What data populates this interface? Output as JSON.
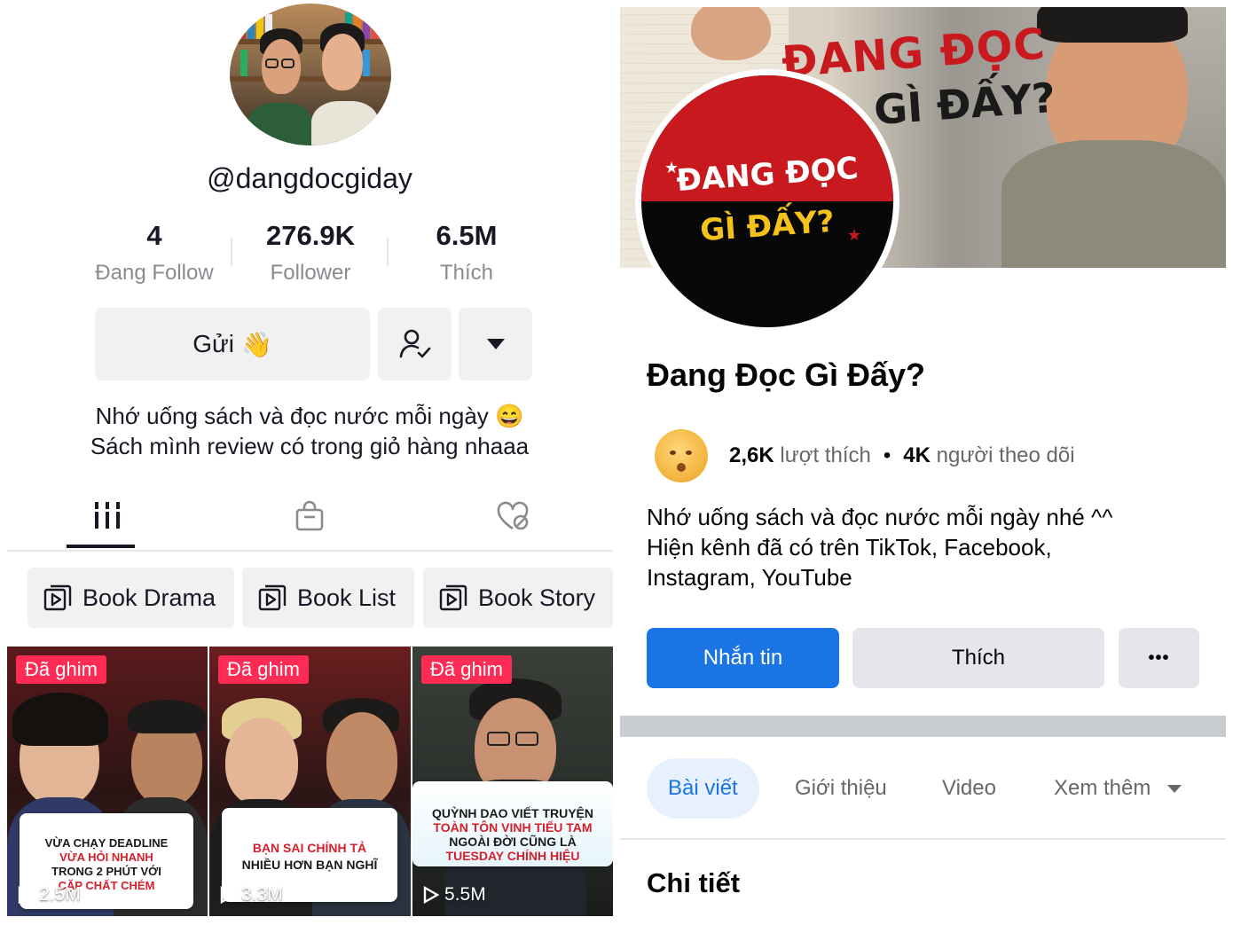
{
  "tiktok": {
    "username": "@dangdocgiday",
    "stats": [
      {
        "value": "4",
        "label": "Đang Follow"
      },
      {
        "value": "276.9K",
        "label": "Follower"
      },
      {
        "value": "6.5M",
        "label": "Thích"
      }
    ],
    "send_button": "Gửi",
    "send_emoji": "👋",
    "bio_line1": "Nhớ uống sách và đọc nước mỗi ngày 😄",
    "bio_line2": "Sách mình review có trong giỏ hàng nhaaa",
    "playlists": [
      "Book Drama",
      "Book List",
      "Book Story"
    ],
    "videos": [
      {
        "pinned": "Đã ghim",
        "views": "2.5M",
        "card_lines": [
          "VỪA CHẠY DEADLINE",
          "VỪA HỎI NHANH",
          "TRONG 2 PHÚT VỚI",
          "CẶP CHẤT CHÉM"
        ]
      },
      {
        "pinned": "Đã ghim",
        "views": "3.3M",
        "card_lines": [
          "BẠN SAI CHÍNH TẢ",
          "NHIỀU HƠN BẠN NGHĨ"
        ]
      },
      {
        "pinned": "Đã ghim",
        "views": "5.5M",
        "card_lines": [
          "QUỲNH DAO VIẾT TRUYỆN",
          "TOÀN TÔN VINH TIỂU TAM",
          "NGOÀI ĐỜI CŨNG LÀ",
          "TUESDAY CHÍNH HIỆU"
        ]
      }
    ],
    "icons": {
      "send": "waving-hand-icon",
      "friends": "user-check-icon",
      "more": "caret-down-icon",
      "videos_tab": "grid-icon",
      "shop_tab": "shopping-bag-icon",
      "liked_tab": "heart-hidden-icon",
      "playlist": "playlist-icon",
      "play": "play-icon"
    }
  },
  "facebook": {
    "cover_title_line1": "ĐANG ĐỌC",
    "cover_title_line2": "GÌ ĐẤY?",
    "logo_line1": "ĐANG ĐỌC",
    "logo_line2": "GÌ ĐẤY?",
    "page_name": "Đang Đọc Gì Đấy?",
    "likes_count": "2,6K",
    "likes_label": "lượt thích",
    "separator": "•",
    "followers_count": "4K",
    "followers_label": "người theo dõi",
    "bio_line1": "Nhớ uống sách và đọc nước mỗi ngày nhé ^^",
    "bio_line2": "Hiện kênh đã có trên TikTok, Facebook,",
    "bio_line3": "Instagram, YouTube",
    "message_button": "Nhắn tin",
    "like_button": "Thích",
    "more_button": "•••",
    "tabs": [
      "Bài viết",
      "Giới thiệu",
      "Video",
      "Xem thêm"
    ],
    "details_heading": "Chi tiết",
    "colors": {
      "primary_blue": "#1b74e4",
      "logo_red": "#c8191f"
    }
  }
}
